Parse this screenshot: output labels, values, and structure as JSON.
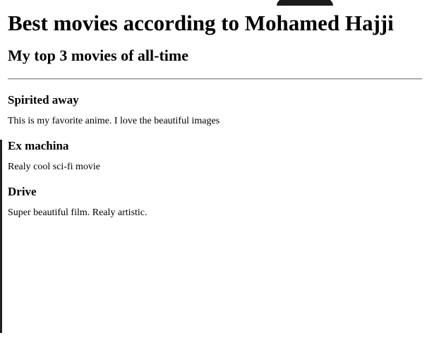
{
  "page": {
    "title": "Best movies according to Mohamed Hajji",
    "subtitle": "My top 3 movies of all-time"
  },
  "movies": [
    {
      "title": "Spirited away",
      "description": "This is my favorite anime. I love the beautiful images"
    },
    {
      "title": "Ex machina",
      "description": "Realy cool sci-fi movie"
    },
    {
      "title": "Drive",
      "description": "Super beautiful film. Realy artistic."
    }
  ]
}
